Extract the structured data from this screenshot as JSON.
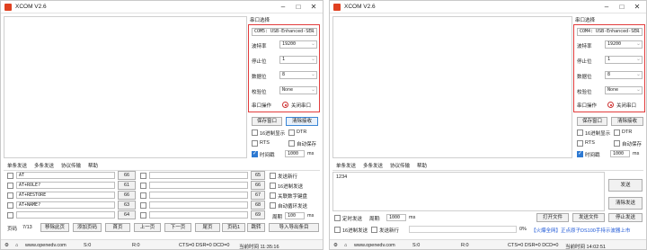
{
  "w1": {
    "title": "XCOM V2.6",
    "serial_group": "串口选择",
    "port": "COM5: USB-Enhanced-SER",
    "baud_label": "波特率",
    "baud": "19200",
    "stop_label": "停止位",
    "stop": "1",
    "data_label": "数据位",
    "data": "8",
    "parity_label": "校验位",
    "parity": "None",
    "op_label": "串口操作",
    "close_btn": "关闭串口",
    "save_btn": "保存窗口",
    "clear_btn": "清除接收",
    "hex_show": "16进制显示",
    "dtr": "DTR",
    "rts": "RTS",
    "auto_save": "自动保存",
    "timestamp": "时间戳",
    "ts_value": "1000",
    "ms": "ms",
    "tabs": [
      "单条发送",
      "多条发送",
      "协议传输",
      "帮助"
    ],
    "cmds": [
      {
        "text": "AT",
        "num": "66"
      },
      {
        "text": "AT+ROLE?",
        "num": "61"
      },
      {
        "text": "AT+RESTORE",
        "num": "66"
      },
      {
        "text": "AT+NAME?",
        "num": "63"
      },
      {
        "text": "",
        "num": "64"
      }
    ],
    "right_nums": [
      "65",
      "66",
      "67",
      "68",
      "69"
    ],
    "send_new_line": "发送新行",
    "hex_send": "16进制发送",
    "assoc_num_kb": "关联数字键盘",
    "auto_loop": "自动循环发送",
    "period_label": "周期",
    "period": "100",
    "period_ms": "ms",
    "page_label": "页码",
    "page": "7/13",
    "move_page": "移除此页",
    "add_page": "添加页码",
    "first": "首页",
    "prev": "上一页",
    "next": "下一页",
    "last": "尾页",
    "page_btn": "页码1",
    "jump": "跳转",
    "import": "导入导出条目",
    "status": {
      "url": "www.openedv.com",
      "s": "S:0",
      "r": "R:0",
      "cts": "CTS=0 DSR=0 DCD=0",
      "time": "当前时间 11:35:16"
    }
  },
  "w2": {
    "title": "XCOM V2.6",
    "serial_group": "串口选择",
    "port": "COM4: USB-Enhanced-SER",
    "baud_label": "波特率",
    "baud": "19200",
    "stop_label": "停止位",
    "stop": "1",
    "data_label": "数据位",
    "data": "8",
    "parity_label": "校验位",
    "parity": "None",
    "op_label": "串口操作",
    "close_btn": "关闭串口",
    "save_btn": "保存窗口",
    "clear_btn": "清除接收",
    "hex_show": "16进制显示",
    "dtr": "DTR",
    "rts": "RTS",
    "auto_save": "自动保存",
    "timestamp": "时间戳",
    "ts_value": "1000",
    "ms": "ms",
    "tabs": [
      "单条发送",
      "多条发送",
      "协议传输",
      "帮助"
    ],
    "send_text": "1234",
    "send_btn": "发送",
    "clear_send": "清除发送",
    "timed_send": "定时发送",
    "period_label": "周期:",
    "period": "1000",
    "period_ms": "ms",
    "open_file": "打开文件",
    "send_file": "发送文件",
    "stop_send": "停止发送",
    "hex_send": "16进制发送",
    "send_new_line": "发送新行",
    "percent": "0%",
    "promo": "【火爆全网】正点原子DS100手持示波器上市",
    "status": {
      "url": "www.openedv.com",
      "s": "S:0",
      "r": "R:0",
      "cts": "CTS=0 DSR=0 DCD=0",
      "time": "当前时间 14:02:51"
    }
  }
}
